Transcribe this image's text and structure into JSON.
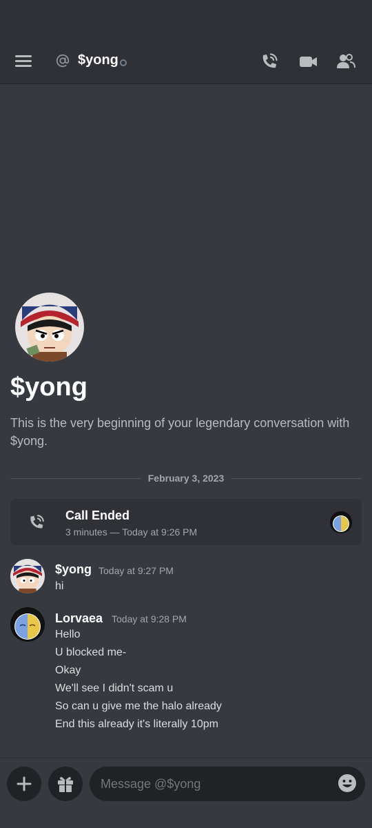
{
  "header": {
    "title": "$yong"
  },
  "welcome": {
    "name": "$yong",
    "description": "This is the very beginning of your legendary conversation with $yong."
  },
  "divider": {
    "date": "February 3, 2023"
  },
  "call": {
    "title": "Call Ended",
    "meta": "3 minutes — Today at 9:26 PM"
  },
  "messages": [
    {
      "author": "$yong",
      "time": "Today at 9:27 PM",
      "lines": [
        "hi"
      ]
    },
    {
      "author": "Lorvaea",
      "time": "Today at 9:28 PM",
      "lines": [
        "Hello",
        "U blocked me-",
        "Okay",
        "We'll see I didn't scam u",
        "So can u give me the halo already",
        "End this already it's literally 10pm"
      ]
    }
  ],
  "composer": {
    "placeholder": "Message @$yong"
  },
  "colors": {
    "background": "#36393f",
    "header": "#2f3136",
    "input": "#202225",
    "text_muted": "#a3a6aa"
  },
  "icons": [
    "hamburger-menu-icon",
    "at-icon",
    "voice-call-icon",
    "video-call-icon",
    "members-icon",
    "plus-icon",
    "gift-icon",
    "emoji-icon"
  ]
}
